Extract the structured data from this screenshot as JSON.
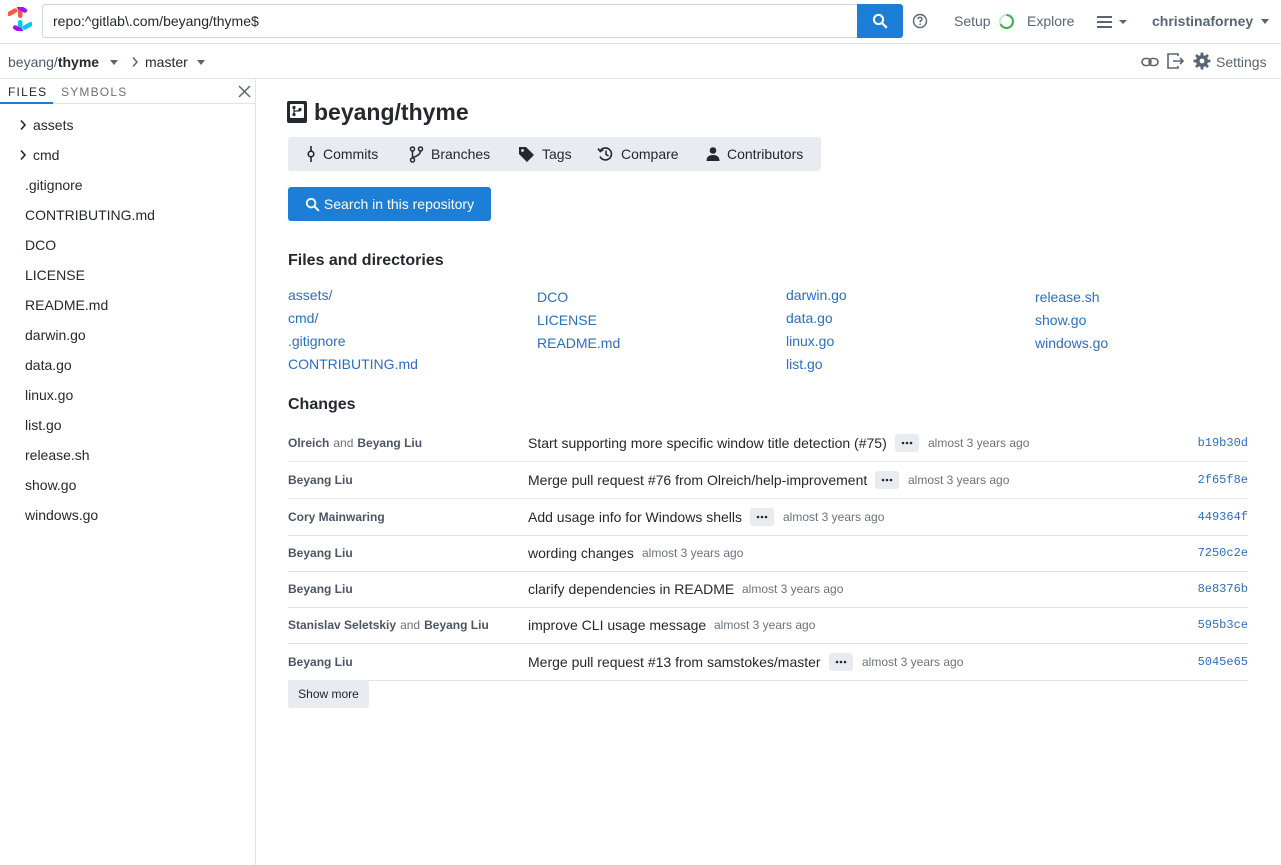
{
  "colors": {
    "accent": "#1c7ed6",
    "link": "#2b6fbf",
    "setup_ring": "#37b24d",
    "button_gray": "#e8ebef"
  },
  "search": {
    "query": "repo:^gitlab\\.com/beyang/thyme$",
    "button_icon": "search-icon"
  },
  "nav": {
    "setup": "Setup",
    "explore": "Explore",
    "user": "christinaforney"
  },
  "repo_bar": {
    "owner": "beyang/",
    "name": "thyme",
    "branch": "master",
    "settings": "Settings"
  },
  "sidebar": {
    "tabs": [
      {
        "label": "FILES"
      },
      {
        "label": "SYMBOLS"
      }
    ],
    "items": [
      {
        "name": "assets",
        "type": "dir"
      },
      {
        "name": "cmd",
        "type": "dir"
      },
      {
        "name": ".gitignore",
        "type": "file"
      },
      {
        "name": "CONTRIBUTING.md",
        "type": "file"
      },
      {
        "name": "DCO",
        "type": "file"
      },
      {
        "name": "LICENSE",
        "type": "file"
      },
      {
        "name": "README.md",
        "type": "file"
      },
      {
        "name": "darwin.go",
        "type": "file"
      },
      {
        "name": "data.go",
        "type": "file"
      },
      {
        "name": "linux.go",
        "type": "file"
      },
      {
        "name": "list.go",
        "type": "file"
      },
      {
        "name": "release.sh",
        "type": "file"
      },
      {
        "name": "show.go",
        "type": "file"
      },
      {
        "name": "windows.go",
        "type": "file"
      }
    ]
  },
  "main": {
    "title": "beyang/thyme",
    "buttons": [
      {
        "label": "Commits"
      },
      {
        "label": "Branches"
      },
      {
        "label": "Tags"
      },
      {
        "label": "Compare"
      },
      {
        "label": "Contributors"
      }
    ],
    "search_repo": "Search in this repository",
    "files_heading": "Files and directories",
    "file_columns": [
      [
        "assets/",
        "cmd/",
        ".gitignore",
        "CONTRIBUTING.md"
      ],
      [
        "DCO",
        "LICENSE",
        "README.md"
      ],
      [
        "darwin.go",
        "data.go",
        "linux.go",
        "list.go"
      ],
      [
        "release.sh",
        "show.go",
        "windows.go"
      ]
    ],
    "changes_heading": "Changes",
    "commits": [
      {
        "author": "Olreich",
        "coauthor": "Beyang Liu",
        "message": "Start supporting more specific window title detection (#75)",
        "has_more": true,
        "time": "almost 3 years ago",
        "hash": "b19b30d"
      },
      {
        "author": "Beyang Liu",
        "coauthor": "",
        "message": "Merge pull request #76 from Olreich/help-improvement",
        "has_more": true,
        "time": "almost 3 years ago",
        "hash": "2f65f8e"
      },
      {
        "author": "Cory Mainwaring",
        "coauthor": "",
        "message": "Add usage info for Windows shells",
        "has_more": true,
        "time": "almost 3 years ago",
        "hash": "449364f"
      },
      {
        "author": "Beyang Liu",
        "coauthor": "",
        "message": "wording changes",
        "has_more": false,
        "time": "almost 3 years ago",
        "hash": "7250c2e"
      },
      {
        "author": "Beyang Liu",
        "coauthor": "",
        "message": "clarify dependencies in README",
        "has_more": false,
        "time": "almost 3 years ago",
        "hash": "8e8376b"
      },
      {
        "author": "Stanislav Seletskiy",
        "coauthor": "Beyang Liu",
        "message": "improve CLI usage message",
        "has_more": false,
        "time": "almost 3 years ago",
        "hash": "595b3ce"
      },
      {
        "author": "Beyang Liu",
        "coauthor": "",
        "message": "Merge pull request #13 from samstokes/master",
        "has_more": true,
        "time": "almost 3 years ago",
        "hash": "5045e65"
      }
    ],
    "and_word": "and",
    "show_more": "Show more"
  }
}
